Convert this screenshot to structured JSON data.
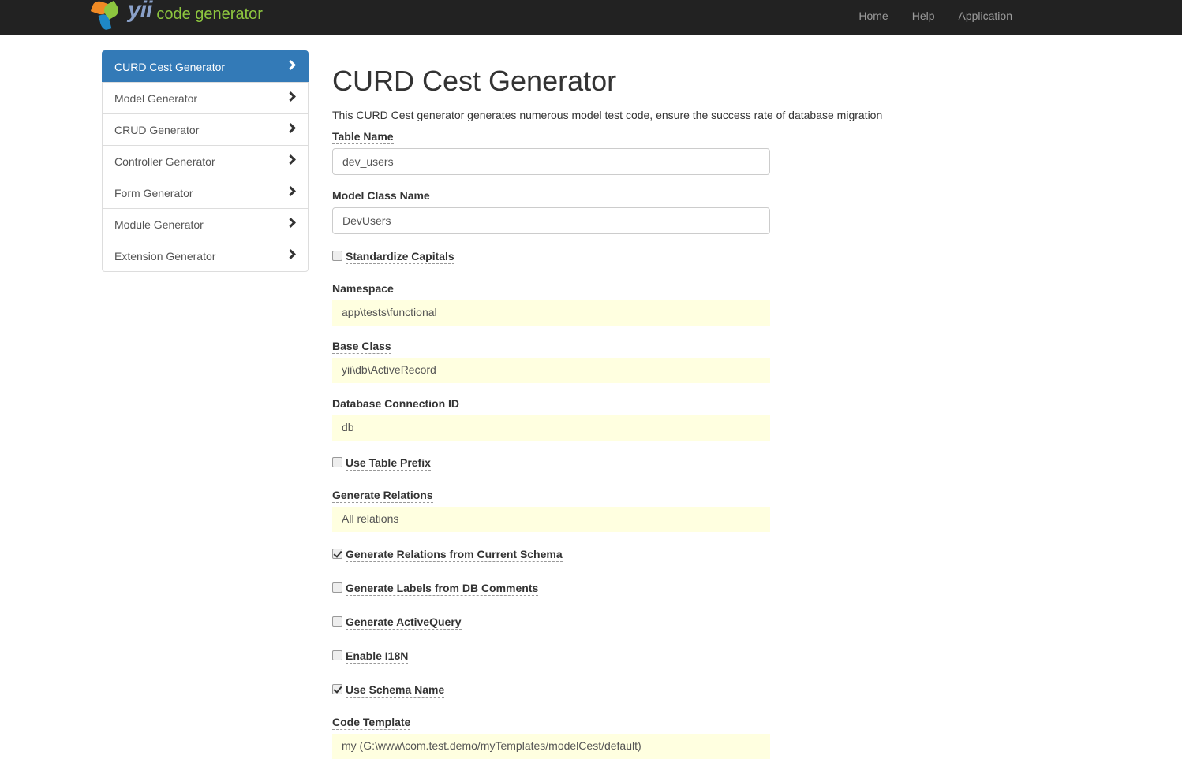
{
  "brand": {
    "yii": "yii",
    "text": "code generator"
  },
  "nav": [
    "Home",
    "Help",
    "Application"
  ],
  "sidebar": [
    {
      "label": "CURD Cest Generator",
      "active": true
    },
    {
      "label": "Model Generator"
    },
    {
      "label": "CRUD Generator"
    },
    {
      "label": "Controller Generator"
    },
    {
      "label": "Form Generator"
    },
    {
      "label": "Module Generator"
    },
    {
      "label": "Extension Generator"
    }
  ],
  "page": {
    "title": "CURD Cest Generator",
    "description": "This CURD Cest generator generates numerous model test code, ensure the success rate of database migration"
  },
  "form": {
    "table_name": {
      "label": "Table Name",
      "value": "dev_users"
    },
    "model_class": {
      "label": "Model Class Name",
      "value": "DevUsers"
    },
    "standardize_capitals": {
      "label": "Standardize Capitals",
      "checked": false
    },
    "namespace": {
      "label": "Namespace",
      "value": "app\\tests\\functional"
    },
    "base_class": {
      "label": "Base Class",
      "value": "yii\\db\\ActiveRecord"
    },
    "db_id": {
      "label": "Database Connection ID",
      "value": "db"
    },
    "use_table_prefix": {
      "label": "Use Table Prefix",
      "checked": false
    },
    "generate_relations": {
      "label": "Generate Relations",
      "value": "All relations"
    },
    "relations_from_schema": {
      "label": "Generate Relations from Current Schema",
      "checked": true
    },
    "labels_from_comments": {
      "label": "Generate Labels from DB Comments",
      "checked": false
    },
    "active_query": {
      "label": "Generate ActiveQuery",
      "checked": false
    },
    "enable_i18n": {
      "label": "Enable I18N",
      "checked": false
    },
    "use_schema_name": {
      "label": "Use Schema Name",
      "checked": true
    },
    "code_template": {
      "label": "Code Template",
      "value": "my (G:\\www\\com.test.demo/myTemplates/modelCest/default)"
    }
  },
  "colors": {
    "navbar": "#222222",
    "active": "#337ab7",
    "sticky": "#ffffe0"
  }
}
